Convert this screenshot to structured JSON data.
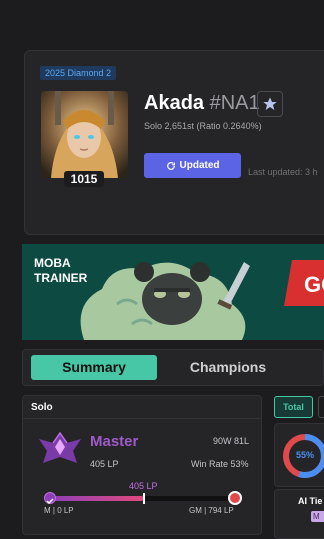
{
  "profile": {
    "season_badge": "2025 Diamond 2",
    "name": "Akada",
    "tag": "#NA1",
    "level": "1015",
    "rank_text": "Solo 2,651st (Ratio 0.2640%)",
    "update_button": "Updated",
    "last_updated": "Last updated: 3 h"
  },
  "banner": {
    "title_line1": "MOBA",
    "title_line2": "TRAINER",
    "cta_partial": "GO"
  },
  "tabs": [
    {
      "label": "Summary",
      "active": true
    },
    {
      "label": "Champions",
      "active": false
    }
  ],
  "solo": {
    "title": "Solo",
    "tier": "Master",
    "lp": "405 LP",
    "record": "90W 81L",
    "win_rate": "Win Rate 53%",
    "bar_lp": "405 LP",
    "bar_progress": 0.51,
    "left_label": "M | 0 LP",
    "right_label": "GM | 794 LP"
  },
  "side": {
    "filter_label": "Total",
    "pie_percent": "55%",
    "pie_value": 0.55,
    "ai_title": "AI Tie",
    "ai_badge": "M"
  },
  "colors": {
    "accent_teal": "#47c7a5",
    "button_blue": "#5c64e6",
    "master_purple": "#a05ac8",
    "gm_red": "#e04a4a"
  }
}
